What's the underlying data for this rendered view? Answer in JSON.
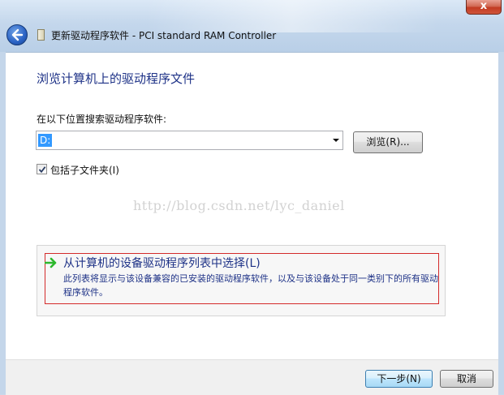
{
  "window": {
    "title": "更新驱动程序软件 - PCI standard RAM Controller",
    "close_label": "x",
    "back_icon": "back-arrow-icon",
    "wizard_icon": "device-icon"
  },
  "main": {
    "heading": "浏览计算机上的驱动程序文件",
    "search_label": "在以下位置搜索驱动程序软件:",
    "path_value": "D:",
    "browse_button": "浏览(R)...",
    "include_subfolders": {
      "label": "包括子文件夹(I)",
      "checked": true
    },
    "watermark": "http://blog.csdn.net/lyc_daniel",
    "pick_option": {
      "title": "从计算机的设备驱动程序列表中选择(L)",
      "description": "此列表将显示与该设备兼容的已安装的驱动程序软件，以及与该设备处于同一类别下的所有驱动程序软件。",
      "icon": "green-arrow-icon",
      "highlight_color": "#d42a2a"
    }
  },
  "footer": {
    "next_button": "下一步(N)",
    "cancel_button": "取消"
  }
}
